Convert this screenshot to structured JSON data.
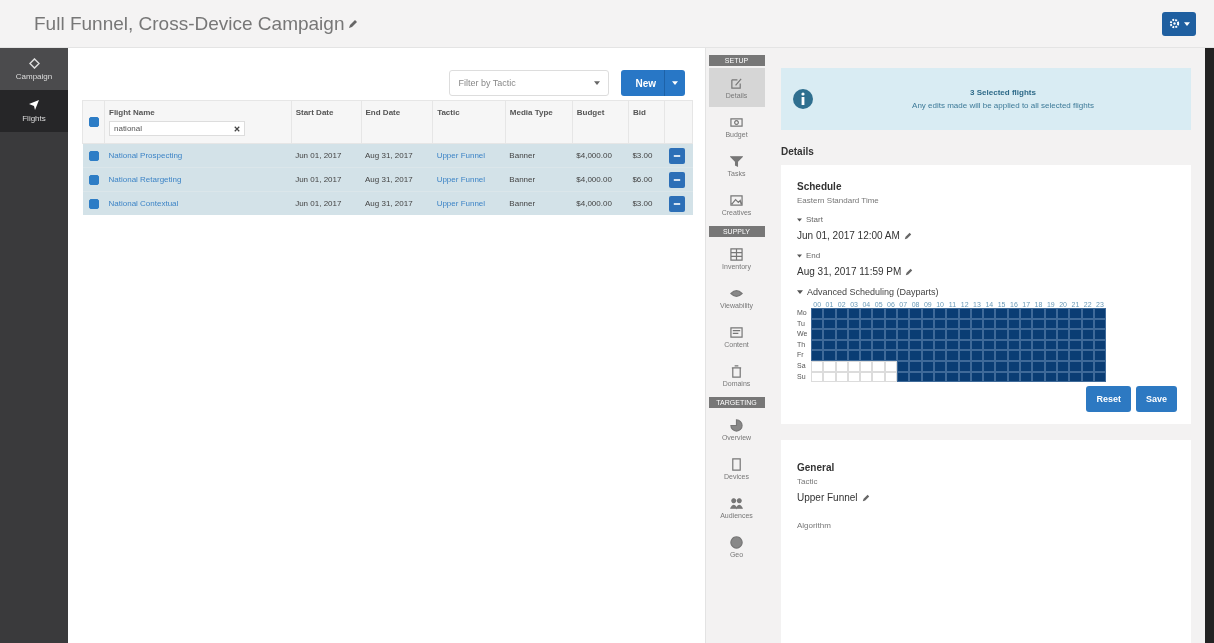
{
  "title": "Full Funnel, Cross-Device Campaign",
  "left_nav": [
    {
      "label": "Campaign",
      "selected": false
    },
    {
      "label": "Flights",
      "selected": true
    }
  ],
  "toolbar": {
    "filter": {
      "placeholder": "Filter by Tactic"
    },
    "new_button": "New"
  },
  "table": {
    "columns": [
      "Flight Name",
      "Start Date",
      "End Date",
      "Tactic",
      "Media Type",
      "Budget",
      "Bid"
    ],
    "name_filter": "national",
    "header_checked": true,
    "rows": [
      {
        "checked": true,
        "cells": [
          "National Prospecting",
          "Jun 01, 2017",
          "Aug 31, 2017",
          "Upper Funnel",
          "Banner",
          "$4,000.00",
          "$3.00"
        ]
      },
      {
        "checked": true,
        "cells": [
          "National Retargeting",
          "Jun 01, 2017",
          "Aug 31, 2017",
          "Upper Funnel",
          "Banner",
          "$4,000.00",
          "$6.00"
        ]
      },
      {
        "checked": true,
        "cells": [
          "National Contextual",
          "Jun 01, 2017",
          "Aug 31, 2017",
          "Upper Funnel",
          "Banner",
          "$4,000.00",
          "$3.00"
        ]
      }
    ]
  },
  "section_nav": [
    {
      "kind": "header",
      "label": "SETUP"
    },
    {
      "kind": "item",
      "label": "Details",
      "selected": true
    },
    {
      "kind": "item",
      "label": "Budget",
      "selected": false
    },
    {
      "kind": "item",
      "label": "Tasks",
      "selected": false
    },
    {
      "kind": "item",
      "label": "Creatives",
      "selected": false
    },
    {
      "kind": "header",
      "label": "SUPPLY"
    },
    {
      "kind": "item",
      "label": "Inventory",
      "selected": false
    },
    {
      "kind": "item",
      "label": "Viewability",
      "selected": false
    },
    {
      "kind": "item",
      "label": "Content",
      "selected": false
    },
    {
      "kind": "item",
      "label": "Domains",
      "selected": false
    },
    {
      "kind": "header",
      "label": "TARGETING"
    },
    {
      "kind": "item",
      "label": "Overview",
      "selected": false
    },
    {
      "kind": "item",
      "label": "Devices",
      "selected": false
    },
    {
      "kind": "item",
      "label": "Audiences",
      "selected": false
    },
    {
      "kind": "item",
      "label": "Geo",
      "selected": false
    }
  ],
  "notice": {
    "title": "3 Selected flights",
    "text": "Any edits made will be applied to all selected flights"
  },
  "details_heading": "Details",
  "schedule": {
    "title": "Schedule",
    "timezone": "Eastern Standard Time",
    "start_label": "Start",
    "start_value": "Jun 01, 2017 12:00 AM",
    "end_label": "End",
    "end_value": "Aug 31, 2017 11:59 PM",
    "advanced_label": "Advanced Scheduling (Dayparts)",
    "hours": [
      "00",
      "01",
      "02",
      "03",
      "04",
      "05",
      "06",
      "07",
      "08",
      "09",
      "10",
      "11",
      "12",
      "13",
      "14",
      "15",
      "16",
      "17",
      "18",
      "19",
      "20",
      "21",
      "22",
      "23"
    ],
    "days": [
      {
        "label": "Mo",
        "on": [
          true,
          true,
          true,
          true,
          true,
          true,
          true,
          true,
          true,
          true,
          true,
          true,
          true,
          true,
          true,
          true,
          true,
          true,
          true,
          true,
          true,
          true,
          true,
          true
        ]
      },
      {
        "label": "Tu",
        "on": [
          true,
          true,
          true,
          true,
          true,
          true,
          true,
          true,
          true,
          true,
          true,
          true,
          true,
          true,
          true,
          true,
          true,
          true,
          true,
          true,
          true,
          true,
          true,
          true
        ]
      },
      {
        "label": "We",
        "on": [
          true,
          true,
          true,
          true,
          true,
          true,
          true,
          true,
          true,
          true,
          true,
          true,
          true,
          true,
          true,
          true,
          true,
          true,
          true,
          true,
          true,
          true,
          true,
          true
        ]
      },
      {
        "label": "Th",
        "on": [
          true,
          true,
          true,
          true,
          true,
          true,
          true,
          true,
          true,
          true,
          true,
          true,
          true,
          true,
          true,
          true,
          true,
          true,
          true,
          true,
          true,
          true,
          true,
          true
        ]
      },
      {
        "label": "Fr",
        "on": [
          true,
          true,
          true,
          true,
          true,
          true,
          true,
          true,
          true,
          true,
          true,
          true,
          true,
          true,
          true,
          true,
          true,
          true,
          true,
          true,
          true,
          true,
          true,
          true
        ]
      },
      {
        "label": "Sa",
        "on": [
          false,
          false,
          false,
          false,
          false,
          false,
          false,
          true,
          true,
          true,
          true,
          true,
          true,
          true,
          true,
          true,
          true,
          true,
          true,
          true,
          true,
          true,
          true,
          true
        ]
      },
      {
        "label": "Su",
        "on": [
          false,
          false,
          false,
          false,
          false,
          false,
          false,
          true,
          true,
          true,
          true,
          true,
          true,
          true,
          true,
          true,
          true,
          true,
          true,
          true,
          true,
          true,
          true,
          true
        ]
      }
    ],
    "buttons": [
      "Reset",
      "Save"
    ]
  },
  "general": {
    "title": "General",
    "tactic_label": "Tactic",
    "tactic_value": "Upper Funnel",
    "algorithm_label": "Algorithm"
  }
}
